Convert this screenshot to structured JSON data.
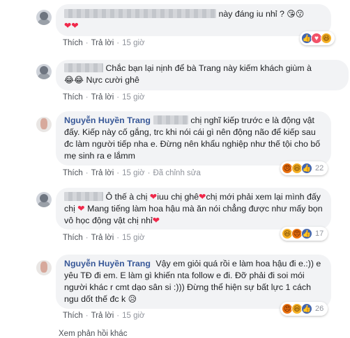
{
  "comments": [
    {
      "avatar": "male-avatar",
      "name": "",
      "text": "này đáng iu nhỉ ?",
      "emoji_after": "😘😗",
      "hearts": "❤❤",
      "actions": {
        "like": "Thích",
        "reply": "Trả lời",
        "time": "15 giờ"
      },
      "reactions": {
        "icons": [
          "like-reaction",
          "love-reaction",
          "haha-reaction"
        ],
        "count": ""
      }
    },
    {
      "avatar": "male-avatar",
      "name": "",
      "text_line1": "Chắc bạn lại nịnh để bà Trang này kiếm khách giùm à",
      "emoji_prefix": "😂😂",
      "text_line2": "Nực cười ghê",
      "actions": {
        "like": "Thích",
        "reply": "Trả lời",
        "time": "15 giờ"
      }
    },
    {
      "avatar": "female-avatar",
      "name": "Nguyễn Huyền Trang",
      "text": "chị nghĩ kiếp trước e là động vật đấy. Kiếp này cố gắng, trc khi nói cái gì nên động não để kiếp sau đc làm người tiếp nha e. Đừng nên khẩu nghiệp như thế tội cho bố mẹ sinh ra e lắmm",
      "actions": {
        "like": "Thích",
        "reply": "Trả lời",
        "time": "15 giờ"
      },
      "edited": "Đã chỉnh sửa",
      "reactions": {
        "icons": [
          "angry-reaction",
          "haha-reaction",
          "like-reaction"
        ],
        "count": "22"
      }
    },
    {
      "avatar": "male-avatar",
      "name": "",
      "parts": [
        "Ô thế à chị ",
        "iuu chị ghê",
        "chị mới phải xem lại mình đấy chị ",
        "Mang tiếng làm hoa hậu mà ăn nói chẳng được như mấy bọn vô học động vật chị nhỉ"
      ],
      "actions": {
        "like": "Thích",
        "reply": "Trả lời",
        "time": "15 giờ"
      },
      "reactions": {
        "icons": [
          "haha-reaction",
          "angry-reaction",
          "like-reaction"
        ],
        "count": "17"
      }
    },
    {
      "avatar": "female-avatar",
      "name": "Nguyễn Huyền Trang",
      "text": "Vậy em giỏi quá rồi e làm hoa hậu đi e.:)) e yêu TĐ đi em. E làm gì khiến nta follow e đi. Đỡ phải đi soi mói người khác r cmt dạo sân si :))) Đừng thể hiện sự bất lực 1 cách ngu dốt thế đc k",
      "emoji_after": "😥",
      "actions": {
        "like": "Thích",
        "reply": "Trả lời",
        "time": "15 giờ"
      },
      "reactions": {
        "icons": [
          "angry-reaction",
          "haha-reaction",
          "like-reaction"
        ],
        "count": "26"
      }
    }
  ],
  "footer": "Xem phản hồi khác"
}
